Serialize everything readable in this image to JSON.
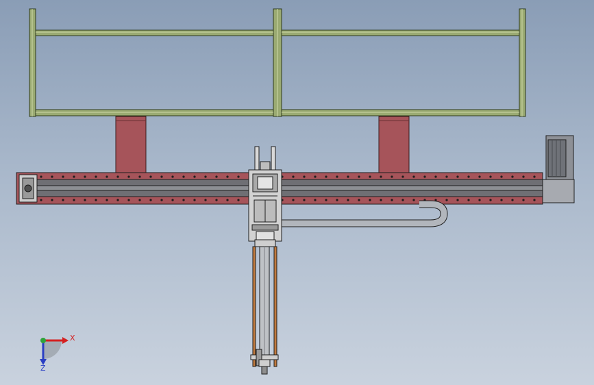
{
  "viewport": {
    "background_top": "#8a9db6",
    "background_bottom": "#c9d2de"
  },
  "colors": {
    "frame": "#9aaa72",
    "frame_outline": "#2e3a1c",
    "pillar": "#a6545a",
    "rail_body": "#a6545a",
    "rail_track": "#6f6f74",
    "carriage": "#d2d2d2",
    "arm_rod": "#c07a3f",
    "cable_tray": "#b2b6bc",
    "motor": "#8d9096",
    "outline": "#1e1e1e"
  },
  "triad": {
    "x_label": "X",
    "z_label": "Z",
    "x_color": "#d42020",
    "y_color": "#2fa33a",
    "z_color": "#2a3fc4"
  }
}
